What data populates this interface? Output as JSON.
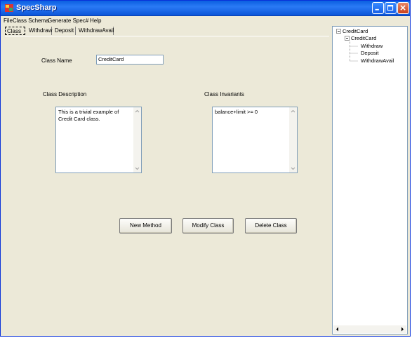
{
  "window": {
    "title": "SpecSharp"
  },
  "menu": [
    "File",
    "Class Schema",
    "Generate Spec#",
    "Help"
  ],
  "tabs": [
    "Class",
    "Withdraw",
    "Deposit",
    "WithdrawAvail"
  ],
  "class_form": {
    "name_label": "Class Name",
    "name_value": "CreditCard",
    "description_label": "Class Description",
    "description_value": "This is a trivial example of Credit Card class.",
    "invariants_label": "Class Invariants",
    "invariants_value": "balance+limit >= 0"
  },
  "buttons": {
    "new_method": "New Method",
    "modify_class": "Modify Class",
    "delete_class": "Delete Class"
  },
  "tree": {
    "root": "CreditCard",
    "child": "CreditCard",
    "methods": [
      "Withdraw",
      "Deposit",
      "WithdrawAvail"
    ]
  },
  "icons": {
    "app": "specsharp-app-icon",
    "minimize": "minimize-icon",
    "maximize": "maximize-icon",
    "close": "close-icon"
  },
  "colors": {
    "titlebar": "#0a5fe0",
    "window_bg": "#ece9d8",
    "field_border": "#7f9db9"
  }
}
